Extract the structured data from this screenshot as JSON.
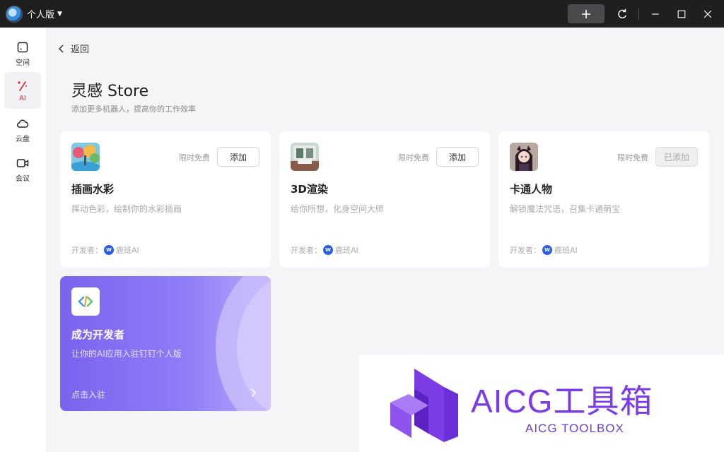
{
  "titlebar": {
    "app_name": "个人版"
  },
  "sidebar": {
    "items": [
      {
        "label": "空间",
        "icon": "square-space-icon"
      },
      {
        "label": "AI",
        "icon": "magic-wand-icon"
      },
      {
        "label": "云盘",
        "icon": "cloud-icon"
      },
      {
        "label": "会议",
        "icon": "video-camera-icon"
      }
    ],
    "active_index": 1
  },
  "nav": {
    "back_label": "返回"
  },
  "header": {
    "title": "灵感 Store",
    "subtitle": "添加更多机器人，提高你的工作效率"
  },
  "cards": [
    {
      "name": "插画水彩",
      "desc": "挥动色彩，绘制你的水彩插画",
      "price": "限时免费",
      "button": "添加",
      "added": false,
      "dev_prefix": "开发者：",
      "dev_name": "鹿班AI"
    },
    {
      "name": "3D渲染",
      "desc": "给你所想，化身空间大师",
      "price": "限时免费",
      "button": "添加",
      "added": false,
      "dev_prefix": "开发者：",
      "dev_name": "鹿班AI"
    },
    {
      "name": "卡通人物",
      "desc": "解锁魔法咒语，召集卡通萌宝",
      "price": "限时免费",
      "button": "已添加",
      "added": true,
      "dev_prefix": "开发者：",
      "dev_name": "鹿班AI"
    }
  ],
  "developer_card": {
    "title": "成为开发者",
    "subtitle": "让你的AI应用入驻钉钉个人版",
    "cta": "点击入驻"
  },
  "watermark": {
    "title": "AICG工具箱",
    "subtitle": "AICG TOOLBOX"
  },
  "colors": {
    "accent_red": "#e0263a",
    "titlebar_bg": "#1f1f1f",
    "developer_purple": "#7a63ee",
    "watermark_purple": "#7b3ce6"
  }
}
